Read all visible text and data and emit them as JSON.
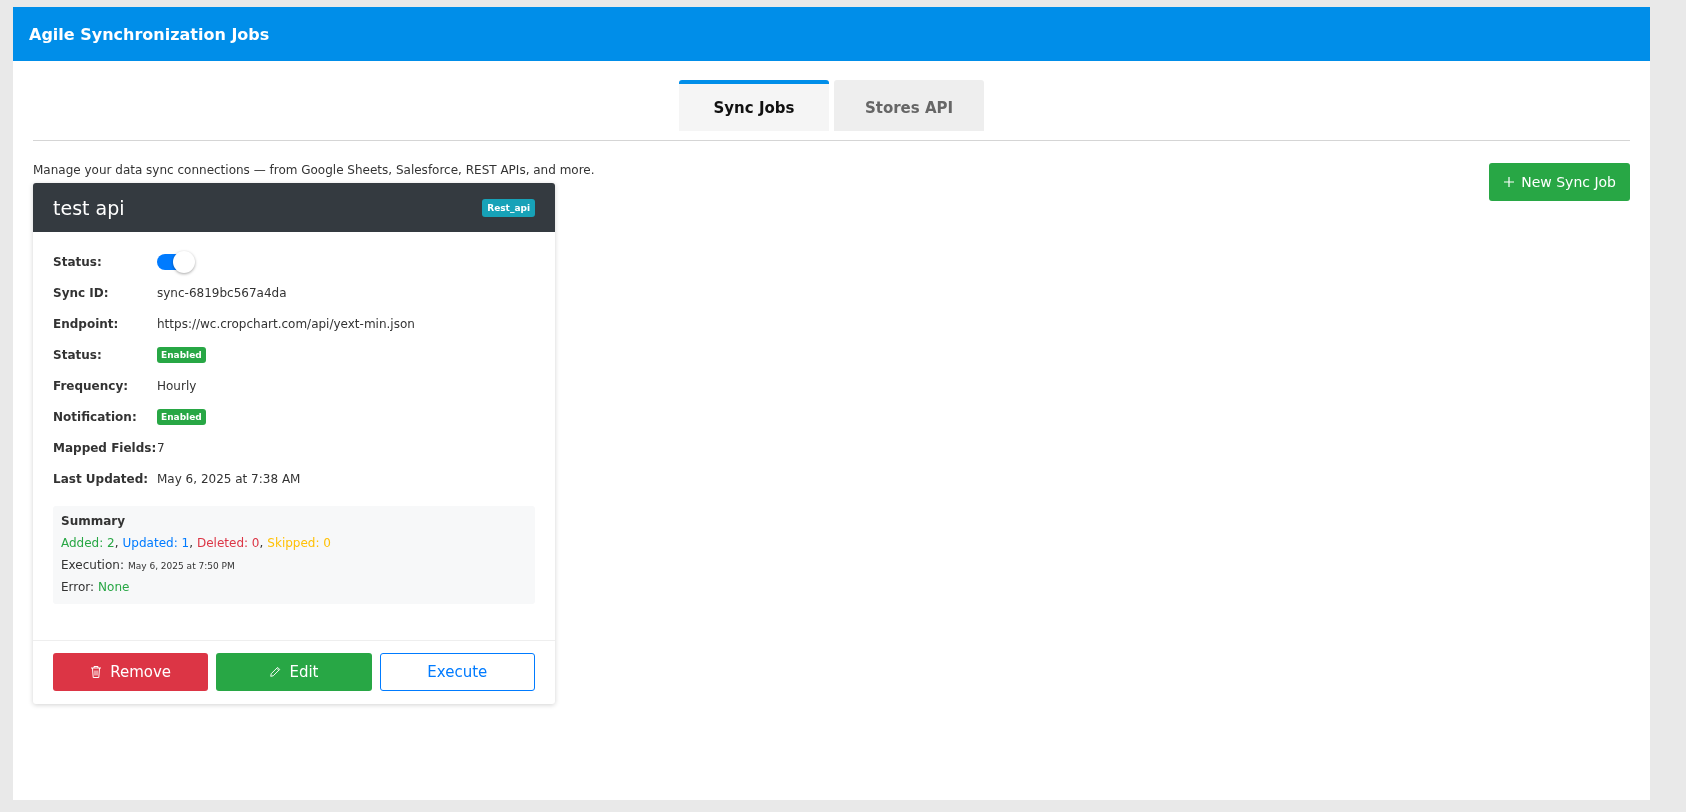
{
  "header": {
    "title": "Agile Synchronization Jobs"
  },
  "tabs": [
    {
      "label": "Sync Jobs",
      "selected": true
    },
    {
      "label": "Stores API",
      "selected": false
    }
  ],
  "description": "Manage your data sync connections — from Google Sheets, Salesforce, REST APIs, and more.",
  "new_button": {
    "label": "New Sync Job"
  },
  "jobs": [
    {
      "title": "test api",
      "type_badge": "Rest_api",
      "fields": [
        {
          "kind": "toggle",
          "label": "Status:",
          "on": true
        },
        {
          "kind": "text",
          "label": "Sync ID:",
          "value": "sync-6819bc567a4da"
        },
        {
          "kind": "text",
          "label": "Endpoint:",
          "value": "https://wc.cropchart.com/api/yext-min.json"
        },
        {
          "kind": "badge",
          "label": "Status:",
          "value": "Enabled"
        },
        {
          "kind": "text",
          "label": "Frequency:",
          "value": "Hourly"
        },
        {
          "kind": "badge",
          "label": "Notification:",
          "value": "Enabled"
        },
        {
          "kind": "text",
          "label": "Mapped Fields:",
          "value": "7"
        },
        {
          "kind": "text",
          "label": "Last Updated:",
          "value": "May 6, 2025 at 7:38 AM"
        }
      ],
      "summary": {
        "title": "Summary",
        "counts": [
          {
            "text": "Added: 2",
            "color": "#28a745",
            "separator": ","
          },
          {
            "text": "Updated: 1",
            "color": "#007bff",
            "separator": ","
          },
          {
            "text": "Deleted: 0",
            "color": "#dc3545",
            "separator": ","
          },
          {
            "text": "Skipped: 0",
            "color": "#ffc107"
          }
        ],
        "execution_label": "Execution:",
        "execution_value": "May 6, 2025 at 7:50 PM",
        "error_label": "Error:",
        "error_value": "None"
      },
      "buttons": [
        {
          "kind": "danger",
          "label": "Remove"
        },
        {
          "kind": "success",
          "label": "Edit"
        },
        {
          "kind": "outline",
          "label": "Execute"
        }
      ]
    }
  ]
}
